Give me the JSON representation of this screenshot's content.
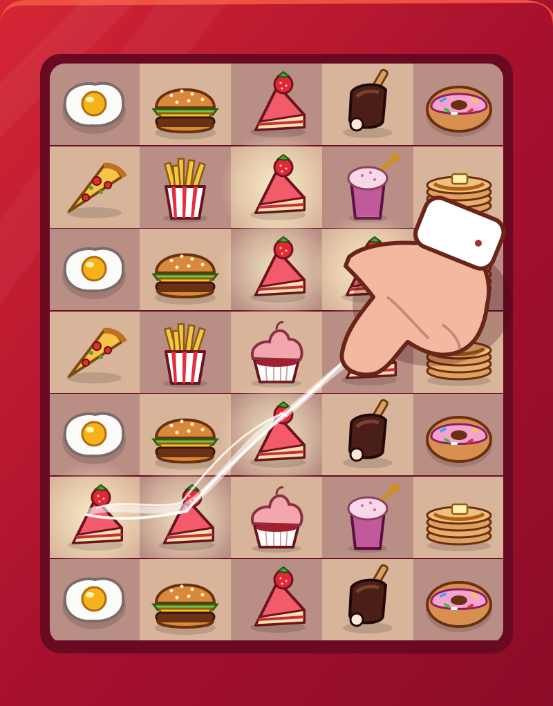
{
  "game": {
    "board": {
      "rows": 7,
      "cols": 5,
      "grid": [
        [
          "egg",
          "burger",
          "cake",
          "icecream",
          "donut"
        ],
        [
          "pizza",
          "fries",
          "cake",
          "shake",
          "pancakes"
        ],
        [
          "egg",
          "burger",
          "cake",
          "cake",
          "pancakes"
        ],
        [
          "pizza",
          "fries",
          "cupcake",
          "cake",
          "pancakes"
        ],
        [
          "egg",
          "burger",
          "cake",
          "icecream",
          "donut"
        ],
        [
          "cake",
          "cake",
          "cupcake",
          "shake",
          "pancakes"
        ],
        [
          "egg",
          "burger",
          "cake",
          "icecream",
          "donut"
        ]
      ],
      "highlighted": [
        [
          1,
          2
        ],
        [
          2,
          2
        ],
        [
          2,
          3
        ],
        [
          4,
          2
        ],
        [
          5,
          0
        ],
        [
          5,
          1
        ]
      ],
      "connected_path": [
        [
          5,
          0
        ],
        [
          5,
          1
        ],
        [
          4,
          2
        ],
        [
          3,
          3
        ]
      ]
    },
    "tutorial_hint": "pointing-hand-icon"
  },
  "colors": {
    "frame": "#a8112e",
    "frame_highlight": "#d82a33",
    "board_border": "#6a0a22",
    "tile_light": "#d8b49b",
    "tile_dark": "#b98e84",
    "glow": "#fff6c8"
  }
}
